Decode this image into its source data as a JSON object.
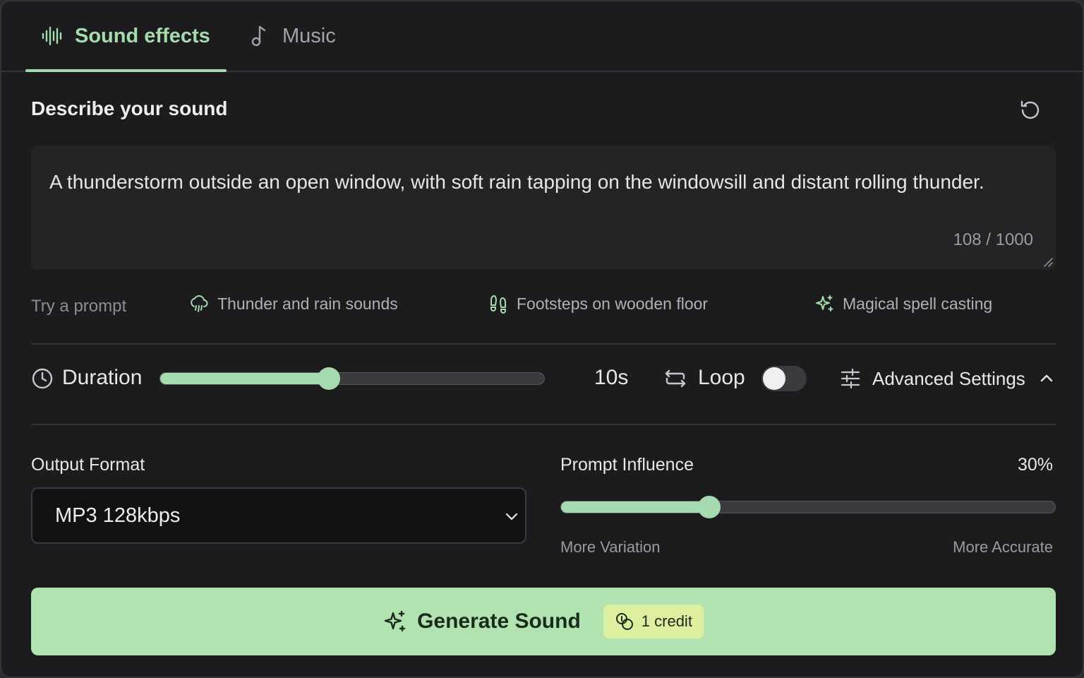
{
  "tabs": [
    {
      "label": "Sound effects",
      "icon": "waveform-icon",
      "active": true
    },
    {
      "label": "Music",
      "icon": "music-note-icon",
      "active": false
    }
  ],
  "header": {
    "title": "Describe your sound",
    "reset_icon": "reset-icon"
  },
  "prompt": {
    "text": "A thunderstorm outside an open window, with soft rain tapping on the windowsill and distant rolling thunder.",
    "char_count": "108 / 1000"
  },
  "suggestions": {
    "label": "Try a prompt",
    "items": [
      {
        "label": "Thunder and rain sounds",
        "icon": "cloud-rain-icon"
      },
      {
        "label": "Footsteps on wooden floor",
        "icon": "footprints-icon"
      },
      {
        "label": "Magical spell casting",
        "icon": "sparkle-icon"
      }
    ]
  },
  "controls": {
    "duration_label": "Duration",
    "duration_value": "10s",
    "duration_fraction": 0.44,
    "loop_label": "Loop",
    "loop_enabled": false,
    "advanced_label": "Advanced Settings",
    "advanced_expanded": true
  },
  "output_format": {
    "label": "Output Format",
    "value": "MP3 128kbps"
  },
  "prompt_influence": {
    "label": "Prompt Influence",
    "value": "30%",
    "fraction": 0.3,
    "min_label": "More Variation",
    "max_label": "More Accurate"
  },
  "generate": {
    "label": "Generate Sound",
    "credit_label": "1 credit"
  },
  "colors": {
    "accent": "#a6dbb0",
    "button": "#b1e3b0",
    "credit_pill": "#dcef9e",
    "panel": "#1c1c1f"
  }
}
